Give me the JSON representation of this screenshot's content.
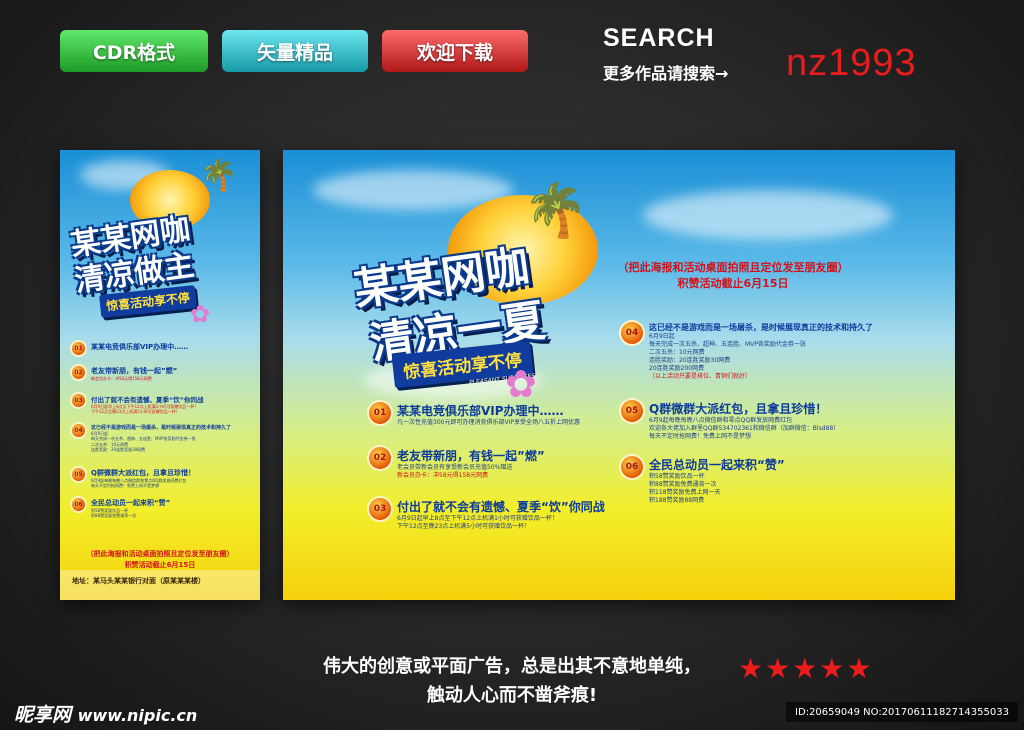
{
  "top": {
    "buttons": [
      "CDR格式",
      "矢量精品",
      "欢迎下载"
    ],
    "search_title": "SEARCH",
    "search_more": "更多作品请搜索→",
    "search_code": "nz1993"
  },
  "poster": {
    "brand_line1": "某某网咖",
    "title_right_line2": "清凉一夏",
    "title_left_line2": "清凉做主",
    "ribbon": "惊喜活动享不停",
    "ribbon_sub": "PLEASANT SURPRISES",
    "promo_note_line1": "（把此海报和活动桌面拍照且定位发至朋友圈）",
    "promo_note_line2": "积赞活动截止6月15日",
    "items": [
      {
        "num": "01",
        "title": "某某电竞俱乐部VIP办理中……",
        "sub": [
          "凡一次性充值300元即可办理消竞俱乐部VIP享受全场八五折上网优惠"
        ]
      },
      {
        "num": "02",
        "title": "老友带新朋，有钱一起”燃”",
        "sub": [
          "老会员带新会员有享受新会员充值50%赠送",
          "新会员办卡：冲58元得158元网费"
        ]
      },
      {
        "num": "03",
        "title": "付出了就不会有遗憾、夏季“饮”你同战",
        "sub": [
          "6月9日起早上8点至下午12点上机满1小时可获赠饮品一杯！",
          "下午12点至晚23点上机满5小时可获赠饮品一杯！"
        ]
      },
      {
        "num": "04",
        "title": "这已经不是游戏而是一场屠杀，是时候展现真正的技术和持久了",
        "sub": [
          "6月9日起",
          "每天完成一次五杀、超神、五连胜、MVP各奖励代金券一张",
          "二次五杀：10元网费",
          "连胜奖励：20连胜奖励30网费",
          "20连胜奖励200网费",
          "（以上活动只要是排位、青铜们就好）"
        ]
      },
      {
        "num": "05",
        "title": "Q群微群大派红包，且拿且珍惜！",
        "sub": [
          "6月9起每晚每晚八点微信群和零点QQ群发放网费红包",
          "欢迎各大佬加入群里QQ群534702361和微信群（加群微信：Blsd88）",
          "每天不定时抢网费！免费上网不是梦想"
        ]
      },
      {
        "num": "06",
        "title": "全民总动员一起来积“赞”",
        "sub": [
          "积58赞奖励饮品一杯",
          "积88赞奖励免费通宵一次",
          "积118赞奖励免费上网一天",
          "积188赞奖励88网费"
        ]
      }
    ],
    "address": "地址：某马头某某银行对面（原某某某楼）"
  },
  "footer": {
    "slogan_line1": "伟大的创意或平面广告，总是出其不意地单纯，",
    "slogan_line2": "触动人心而不凿斧痕!",
    "stars": "★★★★★",
    "logo": "昵享网",
    "logo_url": "www.nipic.cn",
    "id_text": "ID:20659049 NO:20170611182714355033"
  },
  "colors": {
    "accent_red": "#e81d1d",
    "poster_navy": "#0c3b9c"
  },
  "icons": [
    "palm-tree-icon",
    "flower-icon",
    "star-icon"
  ]
}
